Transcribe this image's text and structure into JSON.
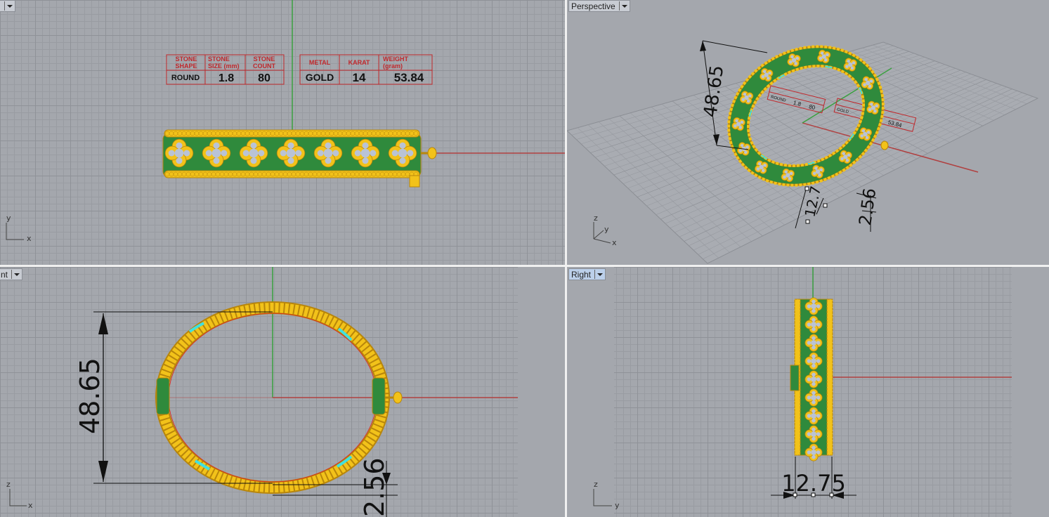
{
  "viewports": {
    "top": {
      "title": ""
    },
    "perspective": {
      "title": "Perspective"
    },
    "front": {
      "title": "nt"
    },
    "right": {
      "title": "Right"
    }
  },
  "axis_labels": {
    "top": {
      "a": "y",
      "b": "x"
    },
    "perspective": {
      "a": "z",
      "b": "y",
      "c": "x"
    },
    "front": {
      "a": "z",
      "b": "x"
    },
    "right": {
      "a": "z",
      "b": "y"
    }
  },
  "stone_table": {
    "h1": [
      "STONE",
      "SHAPE"
    ],
    "h2": [
      "STONE",
      "SIZE (mm)"
    ],
    "h3": [
      "STONE",
      "COUNT"
    ],
    "shape": "ROUND",
    "size": "1.8",
    "count": "80"
  },
  "metal_table": {
    "h1": "METAL",
    "h2": "KARAT",
    "h3": [
      "WEIGHT",
      "(gram)"
    ],
    "metal": "GOLD",
    "karat": "14",
    "weight": "53.84"
  },
  "perspective_labels": {
    "round": "ROUND",
    "size": "1.8",
    "count": "80",
    "gold": "GOLD",
    "weight": "53.84"
  },
  "dimensions": {
    "diameter": "48.65",
    "thickness": "2.56",
    "width": "12.75",
    "width_partial": "12.7"
  },
  "colors": {
    "gold": "#f2c21a",
    "gold_dark": "#b8860b",
    "enamel_green": "#2f8a3c",
    "stone": "#b9c3d6",
    "x_axis": "#b04040",
    "y_axis": "#3aa040",
    "cyan": "#40e0e0"
  }
}
